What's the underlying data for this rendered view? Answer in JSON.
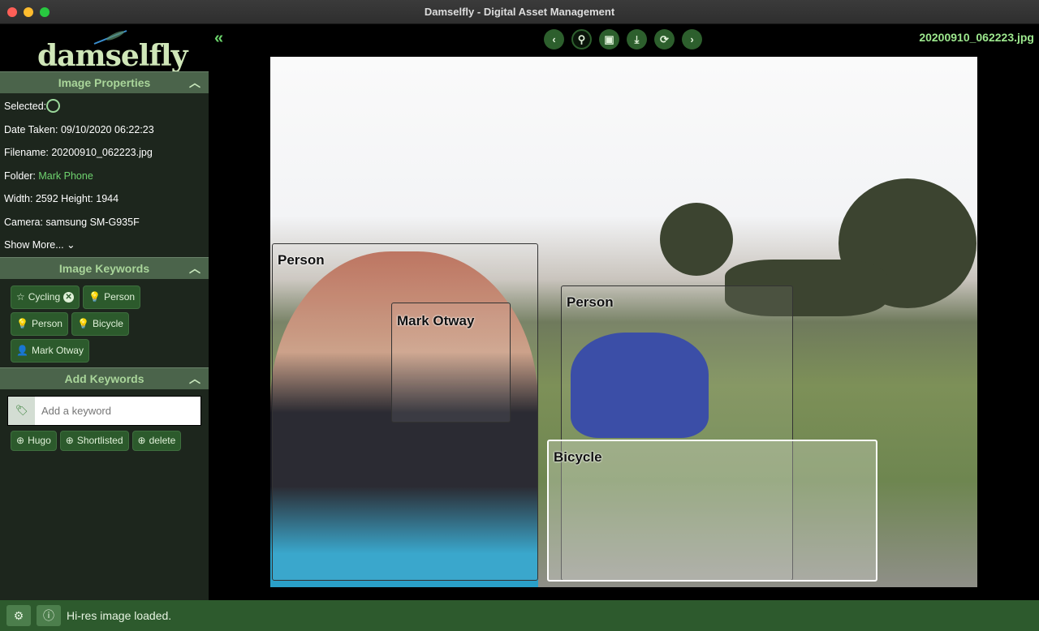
{
  "window": {
    "title": "Damselfly - Digital Asset Management"
  },
  "logo": {
    "text": "damselfly"
  },
  "sidebar": {
    "properties": {
      "header": "Image Properties",
      "selected_label": "Selected:",
      "date_taken": "Date Taken: 09/10/2020 06:22:23",
      "filename": "Filename: 20200910_062223.jpg",
      "folder_label": "Folder: ",
      "folder_value": "Mark Phone",
      "dimensions": "Width: 2592 Height: 1944",
      "camera": "Camera: samsung SM-G935F",
      "show_more": "Show More..."
    },
    "keywords": {
      "header": "Image Keywords",
      "items": [
        {
          "label": "Cycling",
          "icon": "star-icon"
        },
        {
          "label": "Person",
          "icon": "lightbulb-icon"
        },
        {
          "label": "Person",
          "icon": "lightbulb-icon"
        },
        {
          "label": "Bicycle",
          "icon": "lightbulb-icon"
        },
        {
          "label": "Mark Otway",
          "icon": "user-icon"
        }
      ]
    },
    "add_keywords": {
      "header": "Add Keywords",
      "placeholder": "Add a keyword",
      "quick": [
        "Hugo",
        "Shortlisted",
        "delete"
      ]
    }
  },
  "viewer": {
    "filename": "20200910_062223.jpg",
    "boxes": [
      "Person",
      "Mark Otway",
      "Person",
      "Bicycle"
    ]
  },
  "status": {
    "text": "Hi-res image loaded."
  },
  "colors": {
    "accent": "#2d5f2d",
    "header": "#4b644b",
    "sidebar": "#1d261d"
  }
}
